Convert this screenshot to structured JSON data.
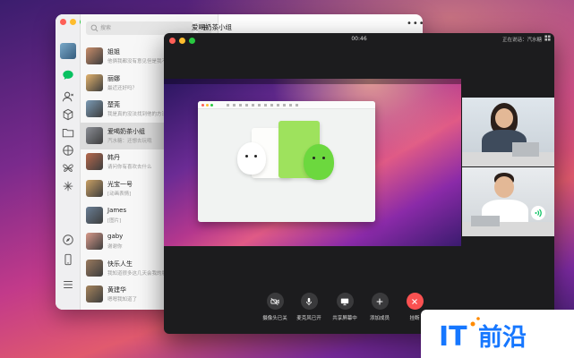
{
  "wechat": {
    "search_placeholder": "搜索",
    "add_label": "+",
    "chat_title": "爱喝奶茶小组",
    "more_label": "•••",
    "chats": [
      {
        "name": "姐姐",
        "msg": "他俩我都没有意见但是我不懂",
        "avatar": "#c98e6a"
      },
      {
        "name": "丽娜",
        "msg": "最近还好吗？",
        "avatar": "#e2b26d"
      },
      {
        "name": "楚莞",
        "msg": "我是真的没法找到他的方法",
        "avatar": "#7b9bb5"
      },
      {
        "name": "爱喝奶茶小组",
        "msg": "汽水糖：还想去玩哦",
        "avatar": "#8c8f96"
      },
      {
        "name": "韩丹",
        "msg": "请问你有喜欢去什么",
        "avatar": "#b7694d"
      },
      {
        "name": "光宝一号",
        "msg": "[动画表情]",
        "avatar": "#c9a064"
      },
      {
        "name": "James",
        "msg": "[图片]",
        "avatar": "#6a7f95"
      },
      {
        "name": "gaby",
        "msg": "谢谢你",
        "avatar": "#d89a8a"
      },
      {
        "name": "快乐人生",
        "msg": "我知道很多这几天会我的朋",
        "avatar": "#9a7a5e"
      },
      {
        "name": "黄建华",
        "msg": "嗯嗯我知道了",
        "avatar": "#a6845c"
      }
    ]
  },
  "call": {
    "timer": "00:46",
    "speaking_label": "正在说话：汽水糖",
    "controls": [
      {
        "label": "摄像头已关",
        "icon": "camera-off-icon"
      },
      {
        "label": "麦克风已开",
        "icon": "microphone-icon"
      },
      {
        "label": "共享屏幕中",
        "icon": "screen-share-icon"
      },
      {
        "label": "添加成员",
        "icon": "add-member-icon"
      },
      {
        "label": "挂断",
        "icon": "hang-up-icon"
      }
    ]
  },
  "watermark": {
    "text": "IT前沿",
    "colors": {
      "blue": "#1677ff",
      "orange": "#ff8a00"
    }
  },
  "colors": {
    "accent_green": "#07c160",
    "hangup_red": "#fa5151"
  }
}
